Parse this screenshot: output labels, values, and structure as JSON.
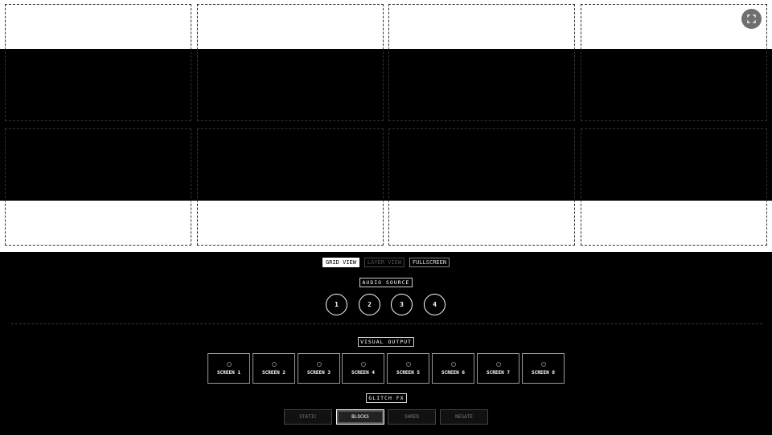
{
  "viewer": {
    "fullscreen_icon": "expand-icon"
  },
  "view_modes": [
    {
      "label": "GRID VIEW",
      "state": "active"
    },
    {
      "label": "LAYER VIEW",
      "state": "disabled"
    },
    {
      "label": "FULLSCREEN",
      "state": "normal"
    }
  ],
  "audio_source": {
    "label": "AUDIO SOURCE",
    "buttons": [
      "1",
      "2",
      "3",
      "4"
    ]
  },
  "visual_output": {
    "label": "VISUAL OUTPUT",
    "screens": [
      "SCREEN 1",
      "SCREEN 2",
      "SCREEN 3",
      "SCREEN 4",
      "SCREEN 5",
      "SCREEN 6",
      "SCREEN 7",
      "SCREEN 8"
    ]
  },
  "glitch_fx": {
    "label": "GLITCH FX",
    "buttons": [
      {
        "label": "STATIC",
        "active": false
      },
      {
        "label": "BLOCKS",
        "active": true
      },
      {
        "label": "SHRED",
        "active": false
      },
      {
        "label": "NEGATE",
        "active": false
      }
    ]
  }
}
